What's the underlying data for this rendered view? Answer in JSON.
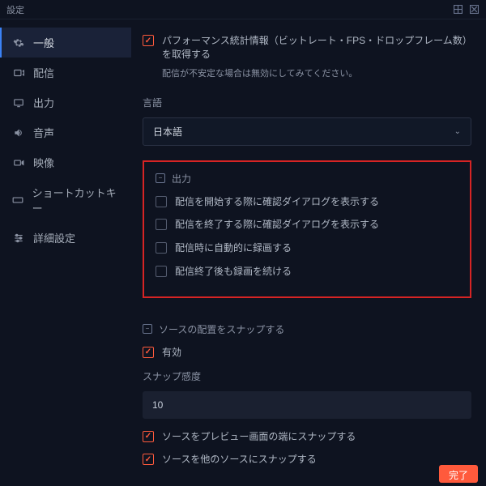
{
  "window": {
    "title": "設定"
  },
  "sidebar": {
    "items": [
      {
        "label": "一般"
      },
      {
        "label": "配信"
      },
      {
        "label": "出力"
      },
      {
        "label": "音声"
      },
      {
        "label": "映像"
      },
      {
        "label": "ショートカットキー"
      },
      {
        "label": "詳細設定"
      }
    ]
  },
  "main": {
    "perf_stats_label": "パフォーマンス統計情報（ビットレート・FPS・ドロップフレーム数）を取得する",
    "perf_stats_note": "配信が不安定な場合は無効にしてみてください。",
    "language_label": "言語",
    "language_value": "日本語",
    "output_section": {
      "title": "出力",
      "items": [
        {
          "label": "配信を開始する際に確認ダイアログを表示する"
        },
        {
          "label": "配信を終了する際に確認ダイアログを表示する"
        },
        {
          "label": "配信時に自動的に録画する"
        },
        {
          "label": "配信終了後も録画を続ける"
        }
      ]
    },
    "snap_section": {
      "title": "ソースの配置をスナップする",
      "enabled_label": "有効",
      "sensitivity_label": "スナップ感度",
      "sensitivity_value": "10",
      "snap_preview_edge": "ソースをプレビュー画面の端にスナップする",
      "snap_other_sources": "ソースを他のソースにスナップする"
    }
  },
  "footer": {
    "done": "完了"
  }
}
